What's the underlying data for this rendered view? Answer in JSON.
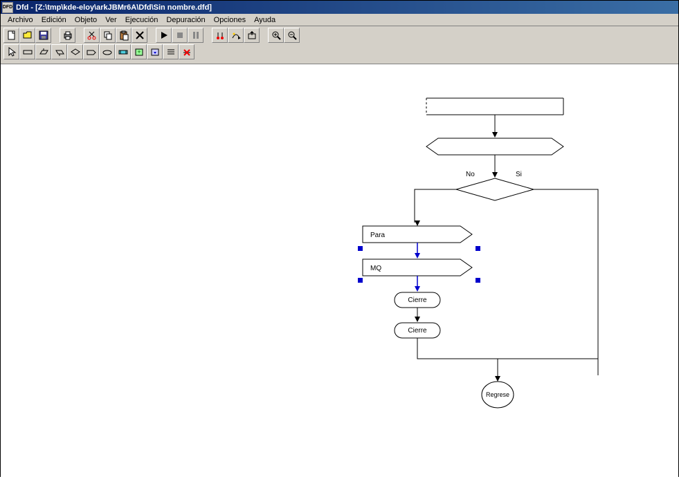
{
  "titlebar": {
    "app": "Dfd",
    "path": "[Z:\\tmp\\kde-eloy\\arkJBMr6A\\Dfd\\Sin nombre.dfd]"
  },
  "menu": {
    "items": [
      "Archivo",
      "Edición",
      "Objeto",
      "Ver",
      "Ejecución",
      "Depuración",
      "Opciones",
      "Ayuda"
    ]
  },
  "toolbar": {
    "row1": {
      "file": [
        "new",
        "open",
        "save"
      ],
      "print": [
        "print"
      ],
      "edit": [
        "cut",
        "copy",
        "paste",
        "delete"
      ],
      "run": [
        "play",
        "stop",
        "pause"
      ],
      "debug": [
        "step-into",
        "step-over",
        "step-out"
      ],
      "zoom": [
        "zoom-in",
        "zoom-out"
      ]
    },
    "row2": {
      "tools": [
        "pointer",
        "process",
        "input",
        "output",
        "decision",
        "loop-for",
        "loop-while",
        "call",
        "new-sub",
        "open-sub",
        "delete-sub",
        "cut-sub"
      ]
    }
  },
  "flowchart": {
    "decision": {
      "no": "No",
      "si": "Si"
    },
    "para": "Para",
    "mq": "MQ",
    "cierre1": "Cierre",
    "cierre2": "Cierre",
    "regrese": "Regrese"
  }
}
